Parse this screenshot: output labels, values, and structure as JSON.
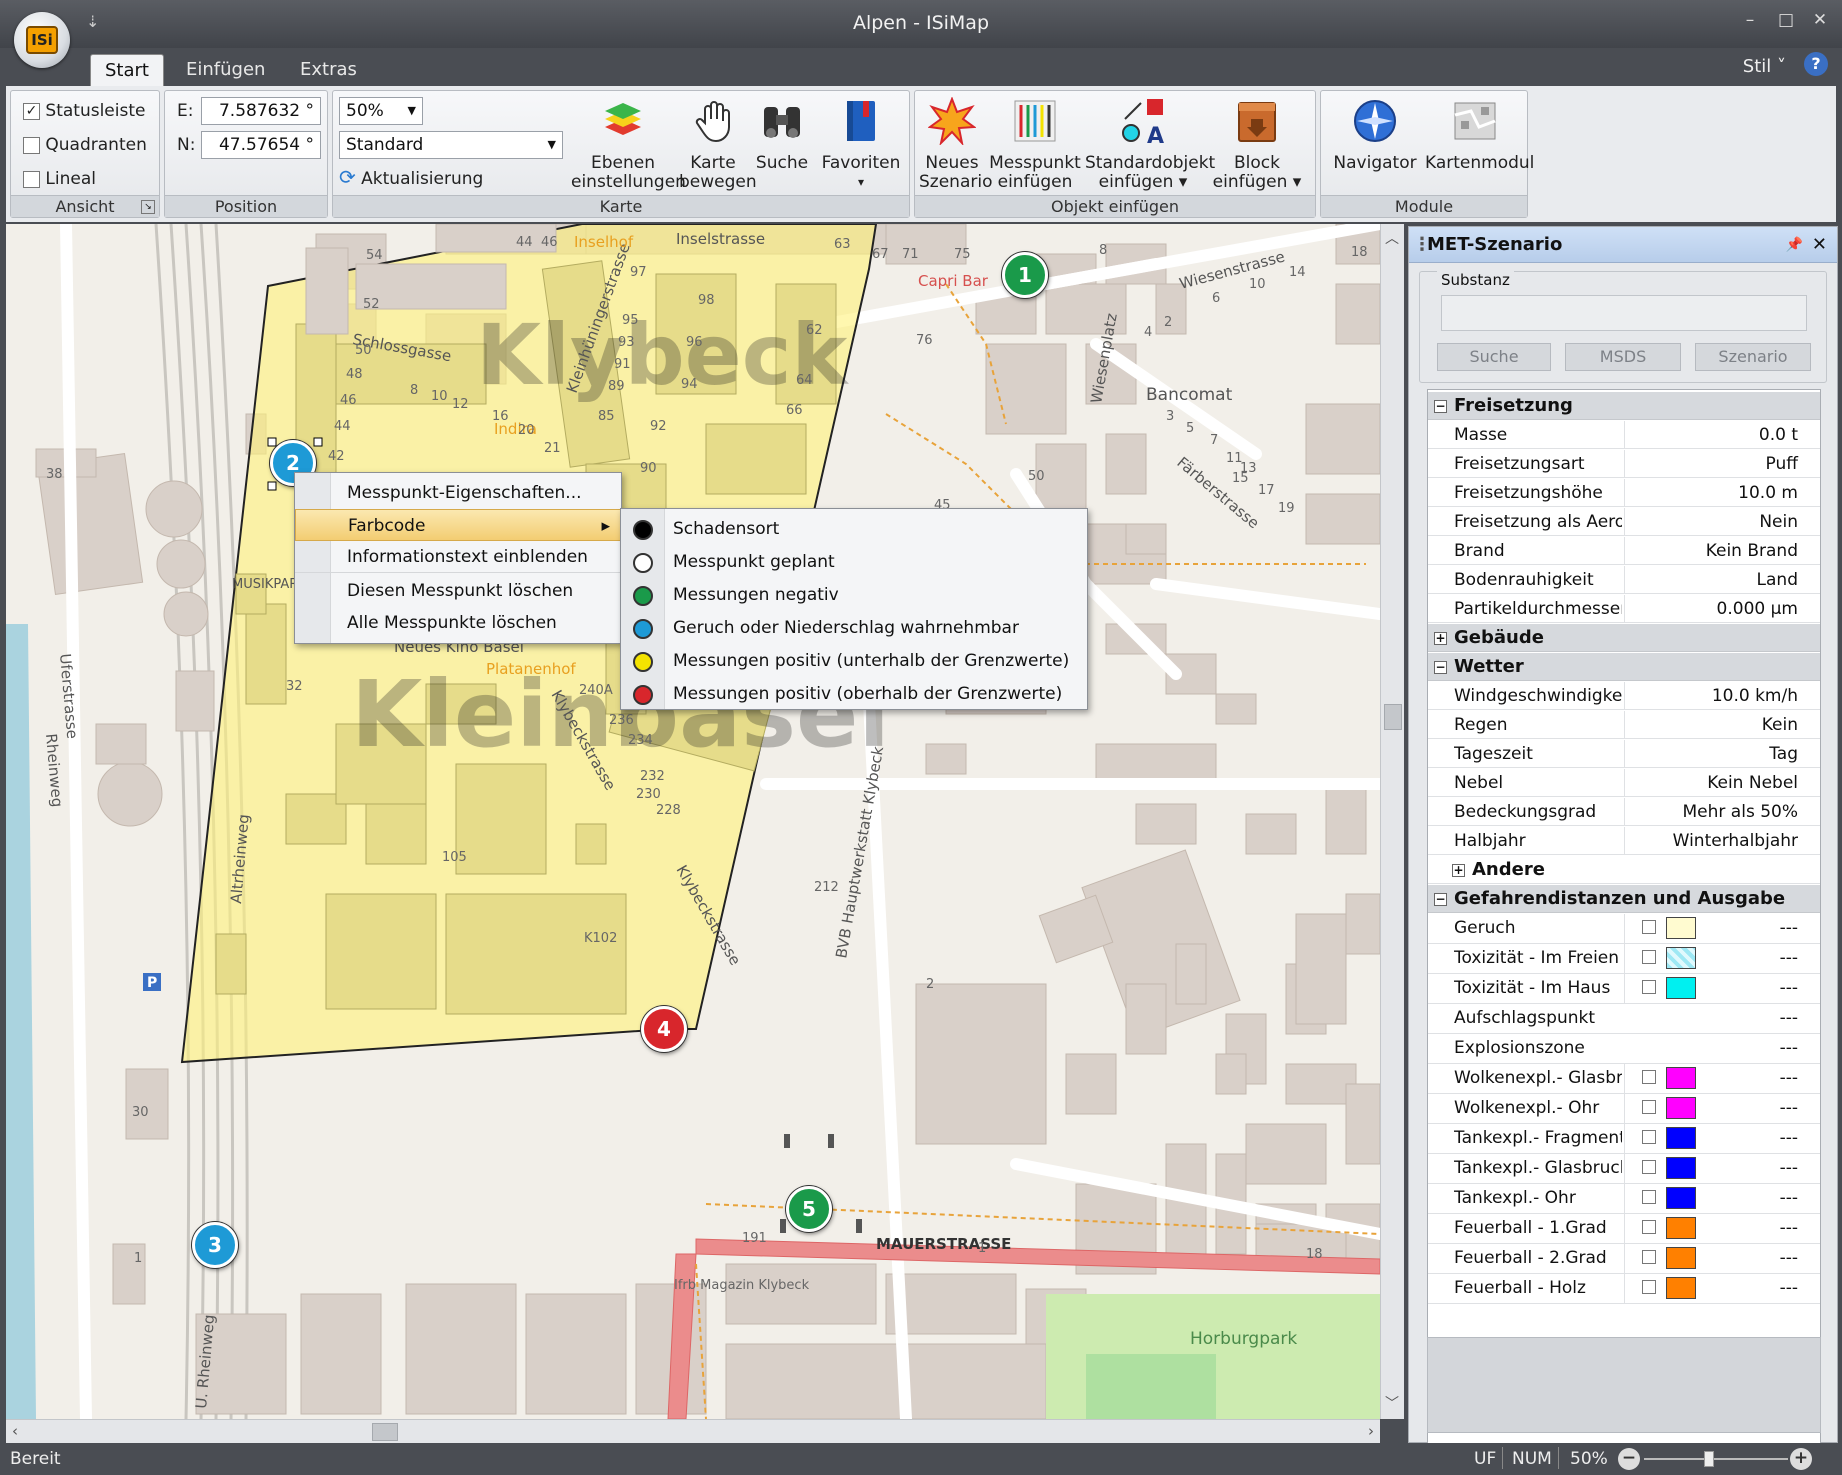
{
  "window": {
    "title": "Alpen - ISiMap",
    "logo_text": "ISi",
    "minimize": "–",
    "maximize": "□",
    "close": "✕",
    "qat": "⇣"
  },
  "tabs": [
    {
      "label": "Start",
      "active": true
    },
    {
      "label": "Einfügen"
    },
    {
      "label": "Extras"
    }
  ],
  "style_menu": "Stil ˅",
  "help": "?",
  "ribbon": {
    "ansicht": {
      "label": "Ansicht",
      "items": [
        {
          "label": "Statusleiste",
          "checked": true
        },
        {
          "label": "Quadranten",
          "checked": false
        },
        {
          "label": "Lineal",
          "checked": false
        }
      ]
    },
    "position": {
      "label": "Position",
      "e_label": "E:",
      "e_value": "7.587632 °",
      "n_label": "N:",
      "n_value": "47.57654 °"
    },
    "karte": {
      "label": "Karte",
      "zoom": "50%",
      "style": "Standard",
      "refresh": "Aktualisierung",
      "buttons": [
        {
          "line1": "Ebenen",
          "line2": "einstellungen",
          "icon": "layers-icon"
        },
        {
          "line1": "Karte",
          "line2": "bewegen",
          "icon": "hand-icon"
        },
        {
          "line1": "Suche",
          "line2": "",
          "icon": "binoculars-icon"
        },
        {
          "line1": "Favoriten",
          "line2": "▾",
          "icon": "book-icon"
        }
      ]
    },
    "objekt": {
      "label": "Objekt einfügen",
      "buttons": [
        {
          "line1": "Neues",
          "line2": "Szenario",
          "icon": "explosion-icon"
        },
        {
          "line1": "Messpunkt",
          "line2": "einfügen",
          "icon": "measure-icon"
        },
        {
          "line1": "Standardobjekt",
          "line2": "einfügen ▾",
          "icon": "shapes-icon"
        },
        {
          "line1": "Block",
          "line2": "einfügen ▾",
          "icon": "block-icon"
        }
      ]
    },
    "module": {
      "label": "Module",
      "buttons": [
        {
          "line1": "Navigator",
          "icon": "navigator-icon"
        },
        {
          "line1": "Kartenmodul",
          "icon": "map-module-icon"
        }
      ]
    }
  },
  "map": {
    "area_labels": [
      "Klybeck",
      "Kleinbasel"
    ],
    "streets": [
      "Uferstrasse",
      "Rheinweg",
      "Altrheinweg",
      "U. Rheinweg",
      "Schlossgasse",
      "Klybeckstrasse",
      "Wiesenstrasse",
      "Färberstrasse",
      "Wiesenplatz",
      "MAUERSTRASSE",
      "Inselstrasse",
      "Kleinhüningerstrasse",
      "BVB Hauptwerkstatt Klybeck"
    ],
    "pois": [
      "Inselhof",
      "Capri Bar",
      "Bancomat",
      "Indira",
      "Neues Kino Basel",
      "Platanenhof",
      "Horburgpark",
      "Ifrb Magazin Klybeck",
      "MUSIKPARK"
    ],
    "numbers": [
      "54",
      "52",
      "50",
      "44",
      "46",
      "48",
      "46",
      "44",
      "42",
      "38",
      "63",
      "67",
      "71",
      "75",
      "8",
      "18",
      "14",
      "10",
      "6",
      "2",
      "4",
      "98",
      "96",
      "94",
      "92",
      "90",
      "62",
      "64",
      "66",
      "76",
      "97",
      "95",
      "93",
      "91",
      "89",
      "85",
      "8",
      "10",
      "12",
      "16",
      "20",
      "21",
      "15",
      "13",
      "11",
      "7",
      "5",
      "3",
      "19",
      "17",
      "45",
      "50",
      "236",
      "234",
      "232",
      "230",
      "228",
      "240A",
      "105",
      "K102",
      "212",
      "2",
      "1",
      "30",
      "32",
      "191",
      "18",
      "1"
    ],
    "markers": [
      {
        "label": "1",
        "color": "#1a9a4a",
        "code": "Messungen negativ"
      },
      {
        "label": "2",
        "color": "#1e9ad6",
        "code": "Geruch oder Niederschlag wahrnehmbar"
      },
      {
        "label": "3",
        "color": "#1e9ad6",
        "code": "Geruch oder Niederschlag wahrnehmbar"
      },
      {
        "label": "4",
        "color": "#d8262c",
        "code": "Messungen positiv (oberhalb der Grenzwerte)"
      },
      {
        "label": "5",
        "color": "#1a9a4a",
        "code": "Messungen negativ"
      }
    ],
    "polygon_fill": "#fff27a",
    "parking": "P"
  },
  "context_menu": {
    "items": [
      "Messpunkt-Eigenschaften...",
      "Farbcode",
      "Informationstext einblenden",
      "Diesen Messpunkt löschen",
      "Alle Messpunkte löschen"
    ],
    "highlighted": "Farbcode",
    "arrow": "▸"
  },
  "submenu": {
    "items": [
      {
        "label": "Schadensort",
        "color": "#000000"
      },
      {
        "label": "Messpunkt geplant",
        "color": "#ffffff"
      },
      {
        "label": "Messungen negativ",
        "color": "#1a9a4a"
      },
      {
        "label": "Geruch oder Niederschlag wahrnehmbar",
        "color": "#1e9ad6"
      },
      {
        "label": "Messungen positiv (unterhalb der Grenzwerte)",
        "color": "#f4e300"
      },
      {
        "label": "Messungen positiv (oberhalb der Grenzwerte)",
        "color": "#d8262c"
      }
    ]
  },
  "panel": {
    "title": "MET-Szenario",
    "pin": "📌",
    "close": "✕",
    "grip": "⋮",
    "substanz_label": "Substanz",
    "substanz_value": "",
    "buttons": [
      "Suche",
      "MSDS",
      "Szenario"
    ],
    "sections": [
      {
        "title": "Freisetzung",
        "expanded": true,
        "rows": [
          {
            "k": "Masse",
            "v": "0.0 t"
          },
          {
            "k": "Freisetzungsart",
            "v": "Puff"
          },
          {
            "k": "Freisetzungshöhe",
            "v": "10.0 m"
          },
          {
            "k": "Freisetzung als Aerosol",
            "v": "Nein"
          },
          {
            "k": "Brand",
            "v": "Kein Brand"
          },
          {
            "k": "Bodenrauhigkeit",
            "v": "Land"
          },
          {
            "k": "Partikeldurchmesser",
            "v": "0.000 µm"
          }
        ]
      },
      {
        "title": "Gebäude",
        "expanded": false,
        "rows": []
      },
      {
        "title": "Wetter",
        "expanded": true,
        "rows": [
          {
            "k": "Windgeschwindigkeit",
            "v": "10.0 km/h"
          },
          {
            "k": "Regen",
            "v": "Kein"
          },
          {
            "k": "Tageszeit",
            "v": "Tag"
          },
          {
            "k": "Nebel",
            "v": "Kein Nebel"
          },
          {
            "k": "Bedeckungsgrad",
            "v": "Mehr als 50%"
          },
          {
            "k": "Halbjahr",
            "v": "Winterhalbjahr"
          }
        ]
      },
      {
        "title": "Andere",
        "expanded": false,
        "sub": true,
        "rows": []
      },
      {
        "title": "Gefahrendistanzen und Ausgabe",
        "expanded": true,
        "rows": [
          {
            "k": "Geruch",
            "v": "---",
            "swatch": "#fffbd0",
            "chk": true
          },
          {
            "k": "Toxizität - Im Freien",
            "v": "---",
            "swatch": "#9ee8f4",
            "chk": true
          },
          {
            "k": "Toxizität - Im Haus",
            "v": "---",
            "swatch": "#00f0f0",
            "chk": true
          },
          {
            "k": "Aufschlagspunkt",
            "v": "---"
          },
          {
            "k": "Explosionszone",
            "v": "---"
          },
          {
            "k": "Wolkenexpl.- Glasbruch",
            "v": "---",
            "swatch": "#ff00ff",
            "chk": true
          },
          {
            "k": "Wolkenexpl.- Ohr",
            "v": "---",
            "swatch": "#ff00ff",
            "chk": true
          },
          {
            "k": "Tankexpl.- Fragment",
            "v": "---",
            "swatch": "#0000ff",
            "chk": true
          },
          {
            "k": "Tankexpl.- Glasbruch",
            "v": "---",
            "swatch": "#0000ff",
            "chk": true
          },
          {
            "k": "Tankexpl.- Ohr",
            "v": "---",
            "swatch": "#0000ff",
            "chk": true
          },
          {
            "k": "Feuerball - 1.Grad",
            "v": "---",
            "swatch": "#ff8000",
            "chk": true
          },
          {
            "k": "Feuerball - 2.Grad",
            "v": "---",
            "swatch": "#ff8000",
            "chk": true
          },
          {
            "k": "Feuerball - Holz",
            "v": "---",
            "swatch": "#ff8000",
            "chk": true
          }
        ]
      }
    ]
  },
  "statusbar": {
    "text": "Bereit",
    "uf": "UF",
    "num": "NUM",
    "zoom": "50%",
    "zoom_out": "−",
    "zoom_in": "+",
    "zoom_level": 0.45
  }
}
